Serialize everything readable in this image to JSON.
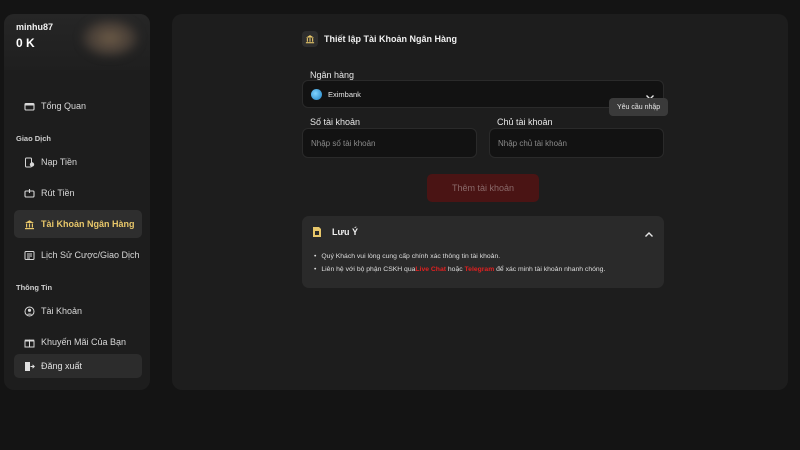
{
  "account": {
    "username": "minhu87",
    "balance": "0 K"
  },
  "nav": {
    "overview": "Tổng Quan",
    "section_transactions": "Giao Dịch",
    "deposit": "Nạp Tiền",
    "withdraw": "Rút Tiền",
    "bank_account": "Tài Khoản Ngân Hàng",
    "history": "Lịch Sử Cược/Giao Dịch",
    "section_info": "Thông Tin",
    "profile": "Tài Khoản",
    "promotions": "Khuyến Mãi Của Bạn",
    "logout": "Đăng xuất"
  },
  "form": {
    "title": "Thiết lập Tài Khoản Ngân Hàng",
    "bank_label": "Ngân hàng",
    "bank_value": "Eximbank",
    "required_tooltip": "Yêu cầu nhập",
    "account_number_label": "Số tài khoản",
    "account_number_placeholder": "Nhập số tài khoản",
    "account_holder_label": "Chủ tài khoản",
    "account_holder_placeholder": "Nhập chủ tài khoản",
    "submit_label": "Thêm tài khoản"
  },
  "note": {
    "title": "Lưu Ý",
    "line1": "Quý Khách vui lòng cung cấp chính xác thông tin tài khoản.",
    "line2_a": "Liên hệ với bộ phận CSKH qua ",
    "line2_live": "Live Chat",
    "line2_b": " hoặc ",
    "line2_tele": "Telegram",
    "line2_c": " để xác minh tài khoản nhanh chóng."
  },
  "colors": {
    "accent_gold": "#e8c76a",
    "button_disabled": "#4a1414",
    "link_red": "#e02020"
  },
  "icons": [
    "wallet-icon",
    "deposit-icon",
    "withdraw-icon",
    "bank-icon",
    "history-icon",
    "user-icon",
    "gift-icon",
    "logout-icon",
    "chevron-down-icon",
    "chevron-up-icon",
    "sim-icon"
  ]
}
